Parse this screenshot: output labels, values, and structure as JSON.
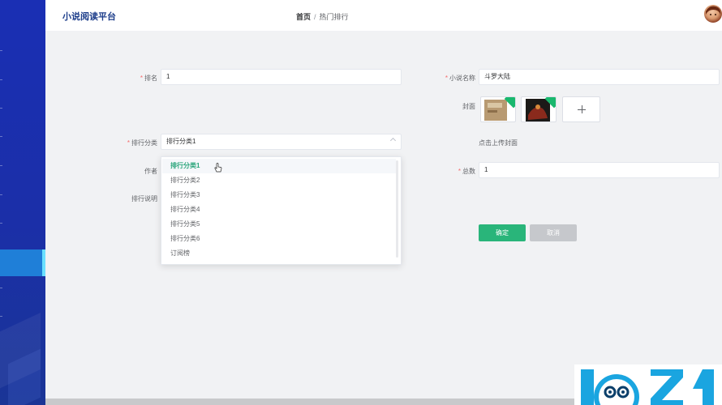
{
  "app": {
    "title": "小说阅读平台"
  },
  "breadcrumb": {
    "home": "首页",
    "separator": "/",
    "current": "热门排行"
  },
  "form": {
    "rank": {
      "label": "排名",
      "value": "1"
    },
    "category": {
      "label": "排行分类",
      "value": "排行分类1"
    },
    "author": {
      "label": "作者"
    },
    "description": {
      "label": "排行说明"
    },
    "novel_name": {
      "label": "小说名称",
      "value": "斗罗大陆"
    },
    "cover": {
      "label": "封面",
      "hint": "点击上传封面"
    },
    "total": {
      "label": "总数",
      "value": "1"
    }
  },
  "dropdown": {
    "options": [
      "排行分类1",
      "排行分类2",
      "排行分类3",
      "排行分类4",
      "排行分类5",
      "排行分类6",
      "订阅榜"
    ],
    "selected": "排行分类1"
  },
  "buttons": {
    "confirm": "确定",
    "cancel": "取消"
  },
  "colors": {
    "sidebar": "#1a2fb4",
    "primary": "#29b57a",
    "required": "#f56c6c",
    "title": "#1c3d8a"
  }
}
